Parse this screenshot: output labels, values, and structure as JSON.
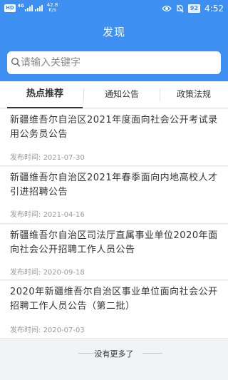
{
  "status_bar": {
    "hd_badge": "HD",
    "signal_label": "4G",
    "net_speed": "42.8",
    "net_unit": "K/s",
    "battery": "92",
    "time": "4:52"
  },
  "header": {
    "title": "发现"
  },
  "search": {
    "placeholder": "请输入关键字"
  },
  "tabs": [
    {
      "label": "热点推荐",
      "active": true
    },
    {
      "label": "通知公告",
      "active": false
    },
    {
      "label": "政策法规",
      "active": false
    }
  ],
  "date_label": "发布时间:",
  "articles": [
    {
      "line1": "新疆维吾尔自治区2021年度面向社会公开考试录",
      "line2": "用公务员公告",
      "date": "2021-07-30"
    },
    {
      "line1": "新疆维吾尔自治区2021年春季面向内地高校人才",
      "line2": "引进招聘公告",
      "date": "2021-04-16"
    },
    {
      "line1": "新疆维吾尔自治区司法厅直属事业单位2020年面",
      "line2": "向社会公开招聘工作人员公告",
      "date": "2020-09-18"
    },
    {
      "line1": "2020年新疆维吾尔自治区事业单位面向社会公开",
      "line2": "招聘工作人员公告（第二批）",
      "date": "2020-07-03"
    }
  ],
  "footer": {
    "text": "没有更多了"
  },
  "colors": {
    "primary": "#3d8ff2",
    "background": "#f2f3f5"
  }
}
